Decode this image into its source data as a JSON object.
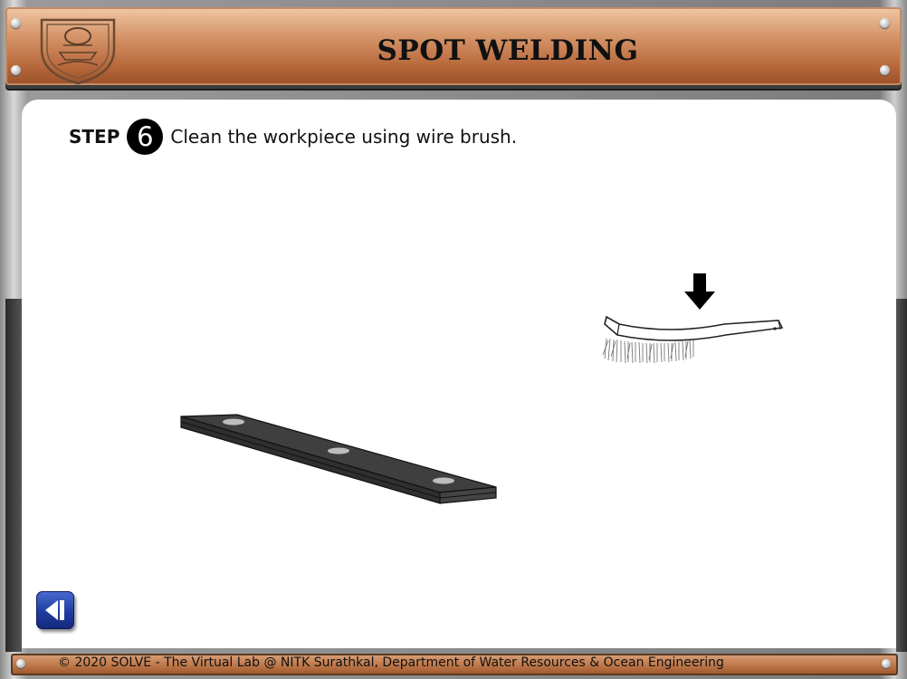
{
  "header": {
    "title": "SPOT WELDING",
    "logo_icon": "nitk-emblem-logo"
  },
  "step": {
    "word": "STEP",
    "number": "6",
    "instruction": "Clean the workpiece using wire brush."
  },
  "scene": {
    "workpiece_icon": "metal-strip-workpiece",
    "brush_icon": "wire-brush",
    "arrow_icon": "down-arrow-icon"
  },
  "nav": {
    "back_icon": "back-icon"
  },
  "footer": {
    "copyright": "© 2020 SOLVE - The Virtual Lab @ NITK Surathkal, Department of Water Resources & Ocean Engineering"
  },
  "colors": {
    "header_brown": "#b8693c",
    "back_button_blue": "#1f3da0",
    "panel_bg": "#ffffff"
  }
}
